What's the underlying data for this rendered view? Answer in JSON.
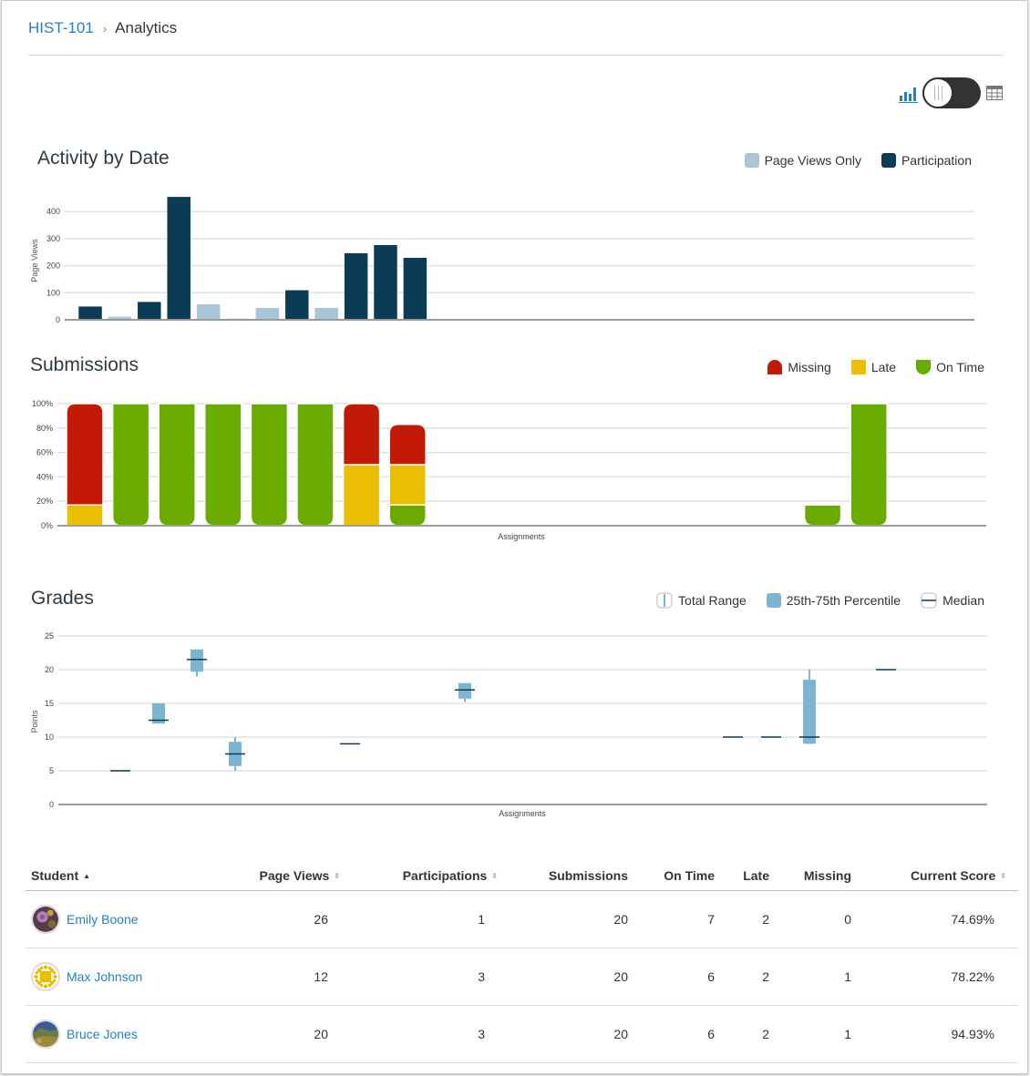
{
  "breadcrumb": {
    "course": "HIST-101",
    "separator": "›",
    "current": "Analytics"
  },
  "view_toggle": {
    "graph_icon": "bar-chart-icon",
    "table_icon": "table-grid-icon",
    "selected": "graph"
  },
  "colors": {
    "link": "#2481c4",
    "page_views_only": "#a9c6d8",
    "participation": "#0c3c55",
    "missing": "#c21a07",
    "late": "#e8bf03",
    "on_time": "#6aab00",
    "percentile": "#7cb5d2",
    "median": "#0c3c55"
  },
  "chart_data": [
    {
      "id": "activity",
      "type": "bar",
      "title": "Activity by Date",
      "ylabel": "Page Views",
      "xlabel": "",
      "ylim": [
        0,
        450
      ],
      "yticks": [
        "0",
        "100",
        "200",
        "300",
        "400"
      ],
      "grid": true,
      "legend_position": "top-right",
      "legend": [
        {
          "label": "Page Views Only",
          "color": "#a9c6d8"
        },
        {
          "label": "Participation",
          "color": "#0c3c55"
        }
      ],
      "bars": [
        {
          "value": 50,
          "kind": "participation"
        },
        {
          "value": 12,
          "kind": "page_views_only"
        },
        {
          "value": 67,
          "kind": "participation"
        },
        {
          "value": 455,
          "kind": "participation"
        },
        {
          "value": 58,
          "kind": "page_views_only"
        },
        {
          "value": 5,
          "kind": "page_views_only"
        },
        {
          "value": 45,
          "kind": "page_views_only"
        },
        {
          "value": 110,
          "kind": "participation"
        },
        {
          "value": 45,
          "kind": "page_views_only"
        },
        {
          "value": 247,
          "kind": "participation"
        },
        {
          "value": 277,
          "kind": "participation"
        },
        {
          "value": 230,
          "kind": "participation"
        }
      ]
    },
    {
      "id": "submissions",
      "type": "bar",
      "stacked": true,
      "title": "Submissions",
      "xlabel": "Assignments",
      "ylabel": "",
      "ylim": [
        0,
        100
      ],
      "yticks": [
        "0%",
        "20%",
        "40%",
        "60%",
        "80%",
        "100%"
      ],
      "grid": true,
      "legend_position": "top-right",
      "legend": [
        {
          "label": "Missing",
          "color": "#c21a07"
        },
        {
          "label": "Late",
          "color": "#e8bf03"
        },
        {
          "label": "On Time",
          "color": "#6aab00"
        }
      ],
      "assignments": [
        {
          "on_time": 0,
          "late": 17,
          "missing": 83
        },
        {
          "on_time": 100,
          "late": 0,
          "missing": 0
        },
        {
          "on_time": 100,
          "late": 0,
          "missing": 0
        },
        {
          "on_time": 100,
          "late": 0,
          "missing": 0
        },
        {
          "on_time": 100,
          "late": 0,
          "missing": 0
        },
        {
          "on_time": 100,
          "late": 0,
          "missing": 0
        },
        {
          "on_time": 0,
          "late": 50,
          "missing": 50
        },
        {
          "on_time": 17,
          "late": 33,
          "missing": 33
        },
        null,
        null,
        null,
        null,
        null,
        null,
        null,
        null,
        {
          "on_time": 17,
          "late": 0,
          "missing": 0
        },
        {
          "on_time": 100,
          "late": 0,
          "missing": 0
        },
        null,
        null
      ]
    },
    {
      "id": "grades",
      "type": "boxplot",
      "title": "Grades",
      "xlabel": "Assignments",
      "ylabel": "Points",
      "ylim": [
        0,
        25
      ],
      "yticks": [
        "0",
        "5",
        "10",
        "15",
        "20",
        "25"
      ],
      "grid": true,
      "legend_position": "top-right",
      "legend": [
        {
          "label": "Total Range",
          "icon": "range"
        },
        {
          "label": "25th-75th Percentile",
          "icon": "box"
        },
        {
          "label": "Median",
          "icon": "median"
        }
      ],
      "assignments": [
        {
          "min": 0,
          "q1": 0,
          "median": 0,
          "q3": 0,
          "max": 0
        },
        {
          "min": 5,
          "q1": 5,
          "median": 5,
          "q3": 5,
          "max": 5
        },
        {
          "min": 12,
          "q1": 12,
          "median": 12.5,
          "q3": 15,
          "max": 15
        },
        {
          "min": 19,
          "q1": 19.7,
          "median": 21.5,
          "q3": 23,
          "max": 23
        },
        {
          "min": 5,
          "q1": 5.7,
          "median": 7.5,
          "q3": 9.3,
          "max": 10
        },
        null,
        null,
        {
          "min": 9,
          "q1": 9,
          "median": 9,
          "q3": 9,
          "max": 9
        },
        null,
        null,
        {
          "min": 15.2,
          "q1": 15.7,
          "median": 17,
          "q3": 18,
          "max": 18
        },
        null,
        null,
        null,
        null,
        {
          "min": 0,
          "q1": 0,
          "median": 0,
          "q3": 0,
          "max": 0
        },
        null,
        {
          "min": 10,
          "q1": 10,
          "median": 10,
          "q3": 10,
          "max": 10
        },
        {
          "min": 10,
          "q1": 10,
          "median": 10,
          "q3": 10,
          "max": 10
        },
        {
          "min": 9,
          "q1": 9,
          "median": 10,
          "q3": 18.5,
          "max": 20
        },
        null,
        {
          "min": 20,
          "q1": 20,
          "median": 20,
          "q3": 20,
          "max": 20
        },
        null,
        null,
        null
      ]
    }
  ],
  "table": {
    "columns": [
      {
        "label": "Student",
        "sort": "asc"
      },
      {
        "label": "Page Views",
        "sort": "sortable"
      },
      {
        "label": "Participations",
        "sort": "sortable"
      },
      {
        "label": "Submissions",
        "sort": "none"
      },
      {
        "label": "On Time",
        "sort": "none"
      },
      {
        "label": "Late",
        "sort": "none"
      },
      {
        "label": "Missing",
        "sort": "none"
      },
      {
        "label": "Current Score",
        "sort": "sortable"
      }
    ],
    "rows": [
      {
        "name": "Emily Boone",
        "avatar": "flower-avatar",
        "page_views": "26",
        "participations": "1",
        "submissions": "20",
        "on_time": "7",
        "late": "2",
        "missing": "0",
        "score": "74.69%"
      },
      {
        "name": "Max Johnson",
        "avatar": "yellow-pattern-avatar",
        "page_views": "12",
        "participations": "3",
        "submissions": "20",
        "on_time": "6",
        "late": "2",
        "missing": "1",
        "score": "78.22%"
      },
      {
        "name": "Bruce Jones",
        "avatar": "landscape-avatar",
        "page_views": "20",
        "participations": "3",
        "submissions": "20",
        "on_time": "6",
        "late": "2",
        "missing": "1",
        "score": "94.93%"
      }
    ]
  }
}
